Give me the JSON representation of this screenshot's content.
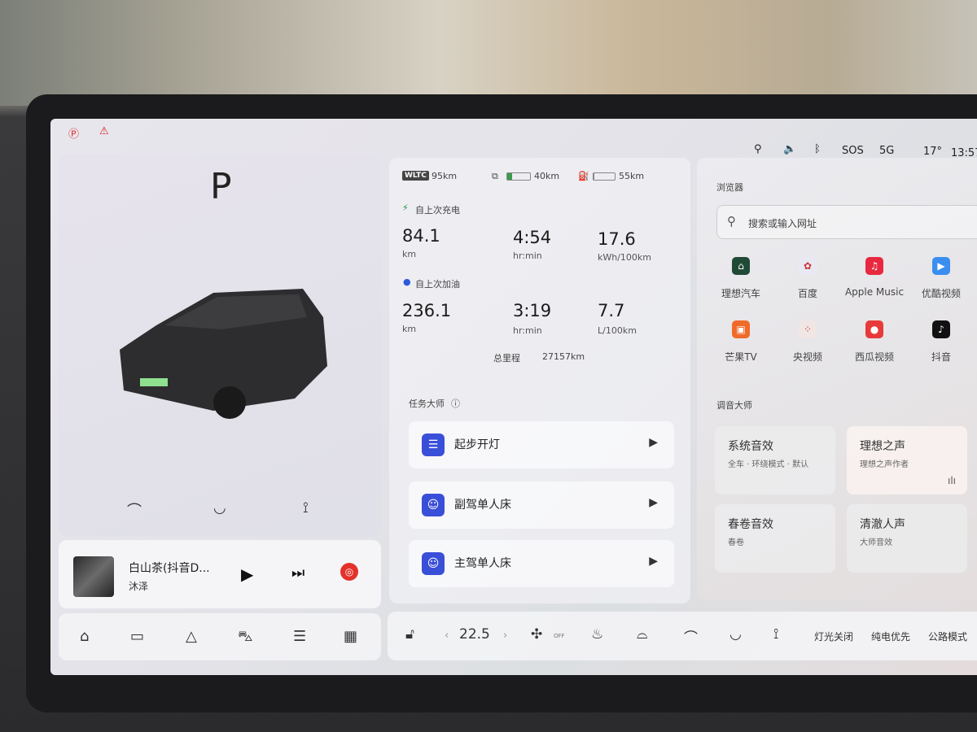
{
  "status_bar": {
    "left_icons": [
      "parking-brake-icon",
      "seatbelt-warning-icon"
    ],
    "icons": [
      "location-icon",
      "volume-icon",
      "bluetooth-icon"
    ],
    "sos": "SOS",
    "network": "5G",
    "temperature": "17°",
    "time": "13:57"
  },
  "vehicle": {
    "gear": "P",
    "quick_controls": [
      "mirror-fold-icon",
      "charge-port-icon",
      "tailgate-icon"
    ]
  },
  "media": {
    "title": "白山茶(抖音D...",
    "artist": "沐泽",
    "controls": [
      "play-icon",
      "next-icon",
      "netease-music-icon"
    ]
  },
  "bottom_nav": [
    "home-icon",
    "vehicle-icon",
    "navigation-icon",
    "car-icon",
    "controls-icon",
    "apps-icon"
  ],
  "energy": {
    "wltc_badge": "WLTC",
    "wltc_range": "95km",
    "battery_range": "40km",
    "battery_level": 0.2,
    "fuel_range": "55km",
    "fuel_level": 0.05,
    "since_charge": {
      "label": "自上次充电",
      "distance": "84.1",
      "distance_unit": "km",
      "time": "4:54",
      "time_unit": "hr:min",
      "consumption": "17.6",
      "consumption_unit": "kWh/100km"
    },
    "since_refuel": {
      "label": "自上次加油",
      "distance": "236.1",
      "distance_unit": "km",
      "time": "3:19",
      "time_unit": "hr:min",
      "consumption": "7.7",
      "consumption_unit": "L/100km"
    },
    "odometer_label": "总里程",
    "odometer": "27157km"
  },
  "tasks": {
    "title": "任务大师",
    "items": [
      {
        "label": "起步开灯"
      },
      {
        "label": "副驾单人床"
      },
      {
        "label": "主驾单人床"
      }
    ]
  },
  "browser": {
    "title": "浏览器",
    "search_placeholder": "搜索或输入网址",
    "apps": [
      {
        "label": "理想汽车",
        "color": "#1f4a36"
      },
      {
        "label": "百度",
        "color": "#e9e9f4"
      },
      {
        "label": "Apple Music",
        "color": "#e8283f"
      },
      {
        "label": "优酷视频",
        "color": "#3a8ef0"
      },
      {
        "label": "芒果TV",
        "color": "#f06a2a"
      },
      {
        "label": "央视频",
        "color": "#f0e6e4"
      },
      {
        "label": "西瓜视频",
        "color": "#e83a3a"
      },
      {
        "label": "抖音",
        "color": "#111111"
      }
    ]
  },
  "sound": {
    "title": "调音大师",
    "cards": [
      {
        "title": "系统音效",
        "sub": "全车 · 环绕模式 · 默认"
      },
      {
        "title": "理想之声",
        "sub": "理想之声作者"
      },
      {
        "title": "春卷音效",
        "sub": "春卷"
      },
      {
        "title": "清澈人声",
        "sub": "大师音效"
      }
    ]
  },
  "climate": {
    "temperature": "22.5",
    "fan": "OFF",
    "buttons": [
      "灯光关闭",
      "纯电优先",
      "公路模式"
    ]
  }
}
